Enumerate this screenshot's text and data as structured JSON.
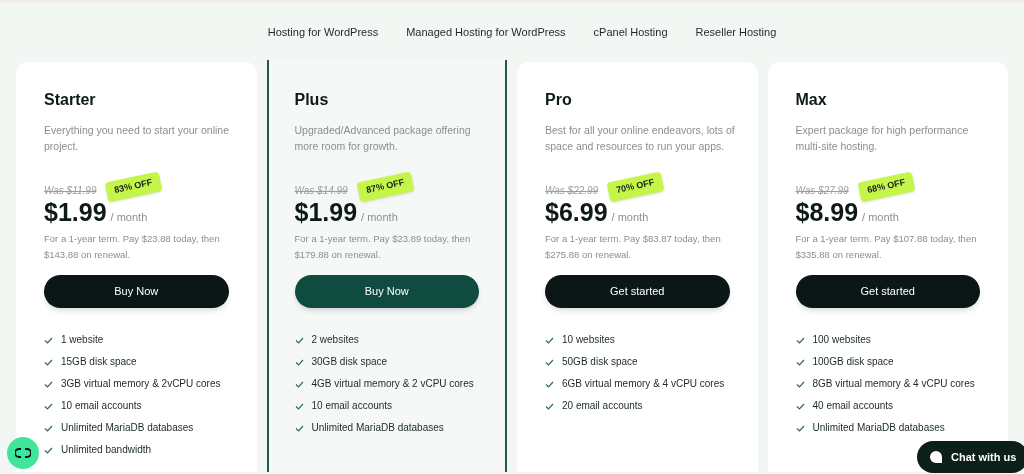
{
  "nav": [
    "Hosting for WordPress",
    "Managed Hosting for WordPress",
    "cPanel Hosting",
    "Reseller Hosting"
  ],
  "plans": [
    {
      "name": "Starter",
      "featured": false,
      "description": "Everything you need to start your online project.",
      "was": "Was $11.99",
      "discount": "83% OFF",
      "price": "$1.99",
      "period": "/ month",
      "term": "For a 1-year term. Pay $23.88 today, then $143.88 on renewal.",
      "button": "Buy Now",
      "features": [
        "1 website",
        "15GB disk space",
        "3GB virtual memory & 2vCPU cores",
        "10 email accounts",
        "Unlimited MariaDB databases",
        "Unlimited bandwidth"
      ]
    },
    {
      "name": "Plus",
      "featured": true,
      "description": "Upgraded/Advanced package offering more room for growth.",
      "was": "Was $14.99",
      "discount": "87% OFF",
      "price": "$1.99",
      "period": "/ month",
      "term": "For a 1-year term. Pay $23.89 today, then $179.88 on renewal.",
      "button": "Buy Now",
      "features": [
        "2 websites",
        "30GB disk space",
        "4GB virtual memory & 2 vCPU cores",
        "10 email accounts",
        "Unlimited MariaDB databases"
      ]
    },
    {
      "name": "Pro",
      "featured": false,
      "description": "Best for all your online endeavors, lots of space and resources to run your apps.",
      "was": "Was $22.99",
      "discount": "70% OFF",
      "price": "$6.99",
      "period": "/ month",
      "term": "For a 1-year term. Pay $83.87 today, then $275.88 on renewal.",
      "button": "Get started",
      "features": [
        "10 websites",
        "50GB disk space",
        "6GB virtual memory & 4 vCPU cores",
        "20 email accounts"
      ]
    },
    {
      "name": "Max",
      "featured": false,
      "description": "Expert package for high performance multi-site hosting.",
      "was": "Was $27.99",
      "discount": "68% OFF",
      "price": "$8.99",
      "period": "/ month",
      "term": "For a 1-year term. Pay $107.88 today, then $335.88 on renewal.",
      "button": "Get started",
      "features": [
        "100 websites",
        "100GB disk space",
        "8GB virtual memory & 4 vCPU cores",
        "40 email accounts",
        "Unlimited MariaDB databases"
      ]
    }
  ],
  "chat_button": "Chat with us"
}
